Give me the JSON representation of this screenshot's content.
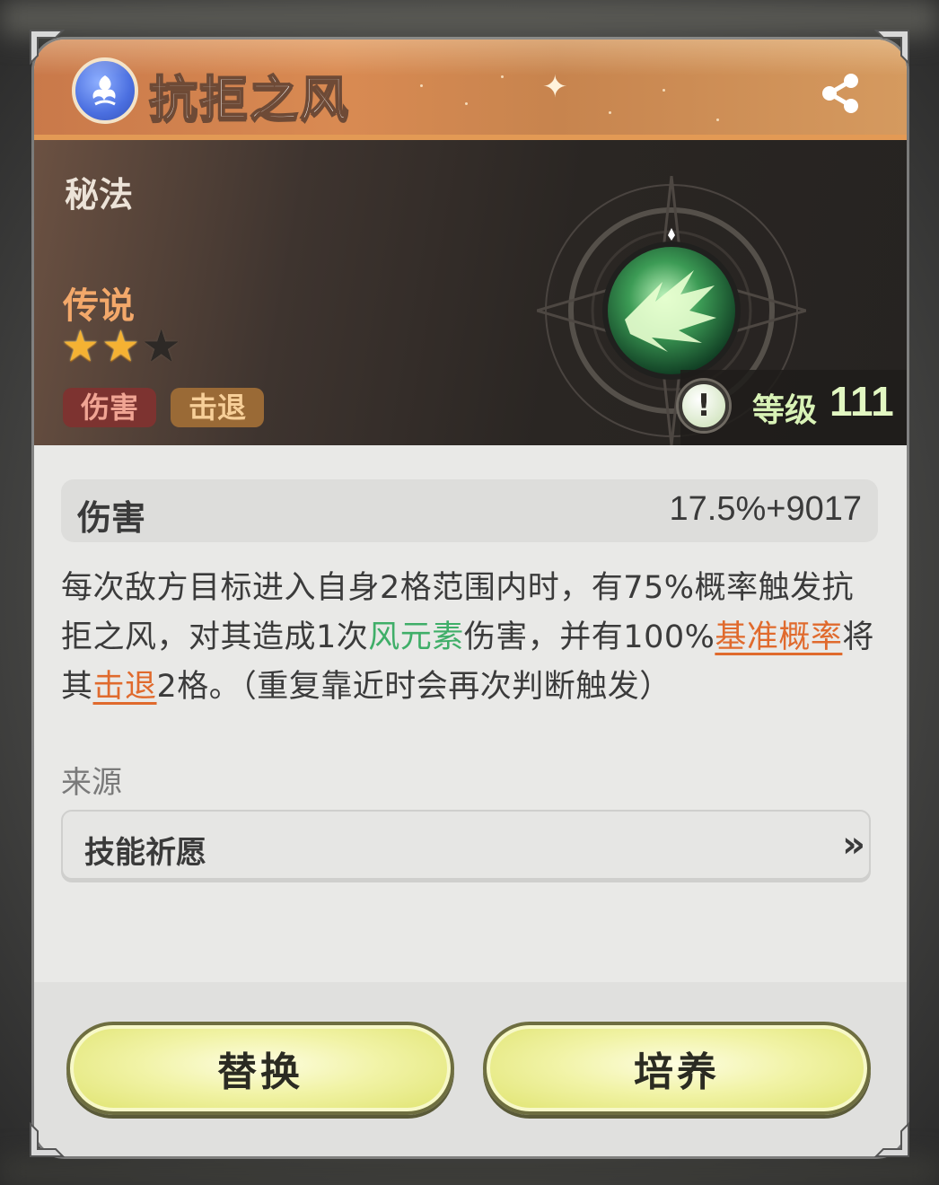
{
  "header": {
    "skill_name": "抗拒之风",
    "skill_badge_icon": "wind-swirl-icon",
    "share_icon": "share-icon"
  },
  "hero": {
    "category": "秘法",
    "rarity": "传说",
    "stars_filled": 2,
    "stars_total": 3,
    "tags": [
      "伤害",
      "击退"
    ],
    "level_label": "等级",
    "level_value": "111",
    "skill_icon": "wind-blade-icon",
    "info_icon": "exclamation-icon"
  },
  "stat": {
    "label": "伤害",
    "value": "17.5%+9017"
  },
  "description": {
    "p1": "每次敌方目标进入自身2格范围内时，有75%概率触发抗拒之风，对其造成1次",
    "wind": "风元素",
    "p2": "伤害，并有100%",
    "link1": "基准概率",
    "p3": "将其",
    "link2": "击退",
    "p4": "2格。（重复靠近时会再次判断触发）"
  },
  "source": {
    "label": "来源",
    "item": "技能祈愿",
    "chevron_icon": "double-chevron-right-icon"
  },
  "buttons": {
    "replace": "替换",
    "cultivate": "培养"
  },
  "colors": {
    "header": "#d98a52",
    "wind_text": "#3fae68",
    "link_text": "#e06a2d",
    "button": "#f1f3a6"
  }
}
